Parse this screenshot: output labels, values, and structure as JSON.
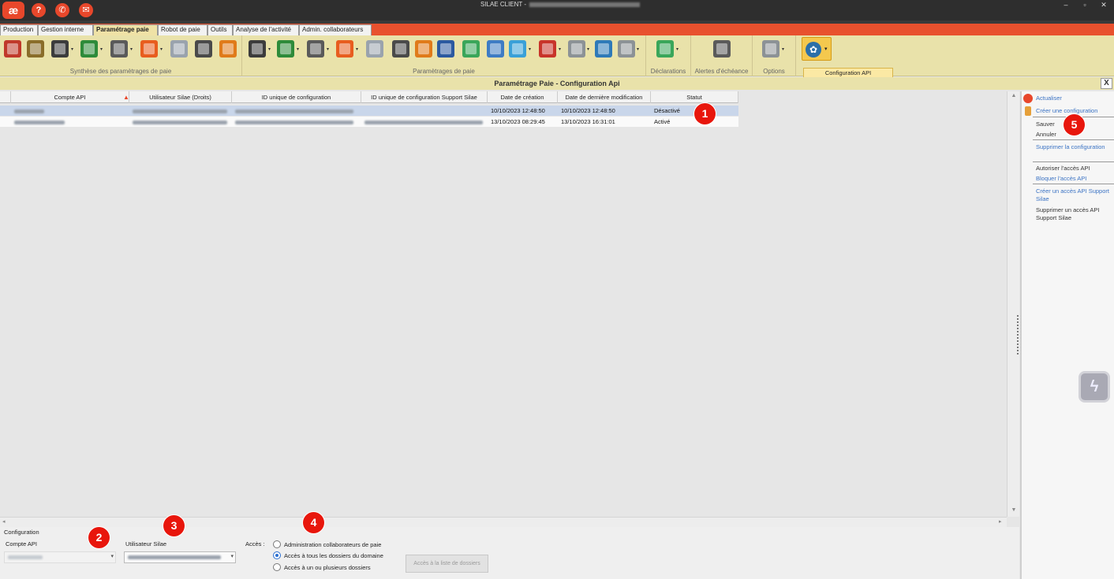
{
  "app": {
    "logo": "æ",
    "title": "SILAE CLIENT -",
    "help": "?",
    "chat": "✆",
    "notif": "✉",
    "win_min": "–",
    "win_max": "▫",
    "win_close": "✕"
  },
  "tabs": [
    {
      "label": "Production"
    },
    {
      "label": "Gestion interne"
    },
    {
      "label": "Paramétrage paie",
      "active": true
    },
    {
      "label": "Robot de paie"
    },
    {
      "label": "Outils"
    },
    {
      "label": "Analyse de l'activité"
    },
    {
      "label": "Admin. collaborateurs"
    }
  ],
  "ribbon": {
    "groups": {
      "synthese": "Synthèse des paramètrages de paie",
      "parametrages": "Paramètrages de paie",
      "declarations": "Déclarations",
      "alertes": "Alertes d'échéance",
      "options": "Options"
    },
    "api_tooltip": "Configuration API"
  },
  "panel": {
    "title": "Paramétrage Paie - Configuration Api",
    "close": "X"
  },
  "grid": {
    "columns": [
      "Compte API",
      "Utilisateur Silae (Droits)",
      "ID unique de configuration",
      "ID unique de configuration Support Silae",
      "Date de création",
      "Date de dernière modification",
      "Statut"
    ],
    "rows": [
      {
        "created": "10/10/2023 12:48:50",
        "modified": "10/10/2023 12:48:50",
        "status": "Désactivé",
        "selected": true
      },
      {
        "created": "13/10/2023 08:29:45",
        "modified": "13/10/2023 16:31:01",
        "status": "Activé",
        "selected": false
      }
    ]
  },
  "side": {
    "refresh": "Actualiser",
    "create": "Créer une configuration",
    "save": "Sauver",
    "cancel": "Annuler",
    "delete": "Supprimer la configuration",
    "authorize": "Autoriser l'accès API",
    "block": "Bloquer l'accès API",
    "create_support": "Créer un accès API Support Silae",
    "delete_support": "Supprimer un accès API Support Silae"
  },
  "config": {
    "section": "Configuration",
    "compte_label": "Compte API",
    "user_label": "Utilisateur Silae",
    "acces_label": "Accès :",
    "options": [
      {
        "label": "Administration collaborateurs de paie",
        "checked": false
      },
      {
        "label": "Accès à tous les dossiers du domaine",
        "checked": true
      },
      {
        "label": "Accès à un ou plusieurs dossiers",
        "checked": false
      }
    ],
    "dossiers_button": "Accès à la liste de dossiers"
  },
  "markers": [
    "1",
    "2",
    "3",
    "4",
    "5"
  ],
  "colors": {
    "accent": "#e8512e",
    "ribbon": "#e9e2aa",
    "marker": "#e8160c",
    "link": "#3b73c4"
  }
}
